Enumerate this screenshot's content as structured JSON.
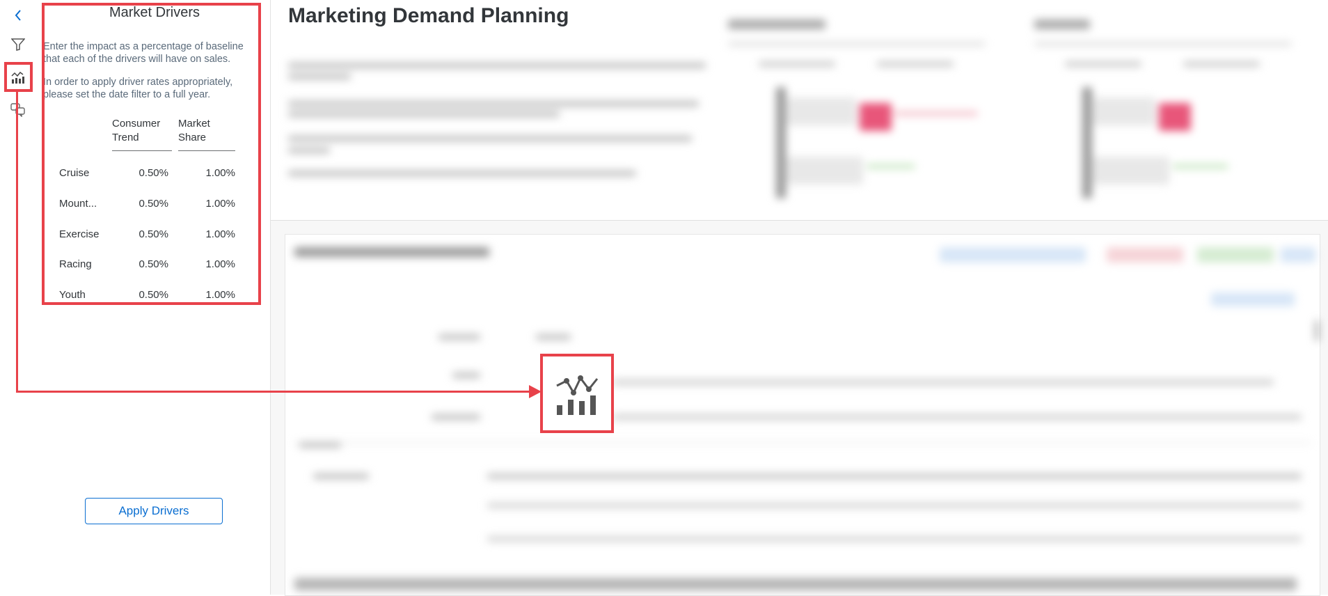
{
  "rail": {
    "back_icon": "chevron-left-icon",
    "filter_icon": "filter-icon",
    "drivers_icon": "line-bar-chart-icon",
    "comments_icon": "discussion-icon"
  },
  "panel": {
    "title": "Market Drivers",
    "description_1": "Enter the impact as a percentage of baseline that each of the drivers will have on sales.",
    "description_2": "In order to apply driver rates appropriately, please set the date filter to a full year.",
    "columns": [
      "Consumer Trend",
      "Market Share"
    ],
    "rows": [
      {
        "name": "Cruise",
        "consumer_trend": "0.50%",
        "market_share": "1.00%"
      },
      {
        "name": "Mount...",
        "consumer_trend": "0.50%",
        "market_share": "1.00%"
      },
      {
        "name": "Exercise",
        "consumer_trend": "0.50%",
        "market_share": "1.00%"
      },
      {
        "name": "Racing",
        "consumer_trend": "0.50%",
        "market_share": "1.00%"
      },
      {
        "name": "Youth",
        "consumer_trend": "0.50%",
        "market_share": "1.00%"
      }
    ],
    "apply_button": "Apply Drivers"
  },
  "main": {
    "title": "Marketing Demand Planning"
  },
  "colors": {
    "accent": "#0a6ed1",
    "highlight": "#e8424a",
    "text": "#32363a"
  }
}
